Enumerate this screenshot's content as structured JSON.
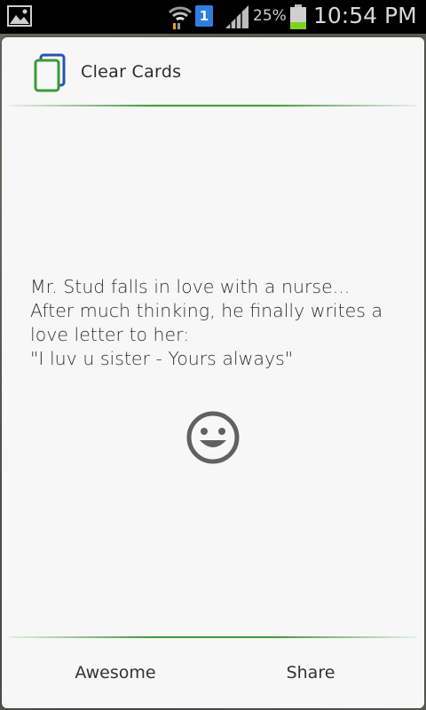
{
  "status_bar": {
    "battery_percent": "25%",
    "sim_slot": "1",
    "time": "10:54 PM",
    "icons": [
      "gallery-icon",
      "wifi-icon",
      "sim-icon",
      "signal-icon",
      "battery-icon"
    ]
  },
  "dialog": {
    "app_title": "Clear Cards",
    "joke_lines": [
      "Mr. Stud falls in love with a nurse...",
      "After much thinking, he finally writes a",
      "love letter to her:",
      "\"I luv u sister - Yours always\""
    ],
    "emoji_icon": "smiley-icon",
    "buttons": {
      "awesome": "Awesome",
      "share": "Share"
    }
  },
  "colors": {
    "divider_green": "#3f9a36",
    "dialog_bg": "#f7f7f7",
    "sim_blue": "#2f7ee0",
    "battery_green": "#7ed321"
  }
}
